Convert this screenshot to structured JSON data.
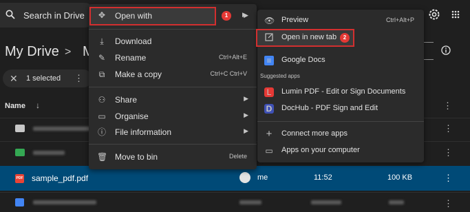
{
  "search": {
    "placeholder": "Search in Drive"
  },
  "page": {
    "breadcrumb_root": "My Drive",
    "breadcrumb_sep": ">",
    "breadcrumb_child": "M"
  },
  "selection": {
    "clear_icon": "close-icon",
    "label": "1 selected"
  },
  "columns": {
    "name": "Name"
  },
  "selected_file": {
    "name": "sample_pdf.pdf",
    "icon_label": "PDF",
    "owner": "me",
    "modified": "11:52",
    "size": "100 KB"
  },
  "context_menu": {
    "open_with": "Open with",
    "download": "Download",
    "rename": "Rename",
    "rename_shortcut": "Ctrl+Alt+E",
    "make_copy": "Make a copy",
    "make_copy_shortcut": "Ctrl+C Ctrl+V",
    "share": "Share",
    "organise": "Organise",
    "file_information": "File information",
    "move_to_bin": "Move to bin",
    "move_to_bin_shortcut": "Delete"
  },
  "submenu": {
    "preview": "Preview",
    "preview_shortcut": "Ctrl+Alt+P",
    "open_new_tab": "Open in new tab",
    "google_docs": "Google Docs",
    "suggested_heading": "Suggested apps",
    "lumin": "Lumin PDF - Edit or Sign Documents",
    "dochub": "DocHub - PDF Sign and Edit",
    "connect_more": "Connect more apps",
    "apps_on_computer": "Apps on your computer"
  },
  "badges": {
    "first": "1",
    "second": "2"
  },
  "icons": {
    "dochub_letter": "D",
    "lumin_letter": "L",
    "docs_letter": "≡"
  },
  "colors": {
    "background": "#1f1f1f",
    "menu": "#2b2b2b",
    "selected_row": "#004a77",
    "highlight_border": "#d32f2f",
    "badge": "#e53935"
  }
}
